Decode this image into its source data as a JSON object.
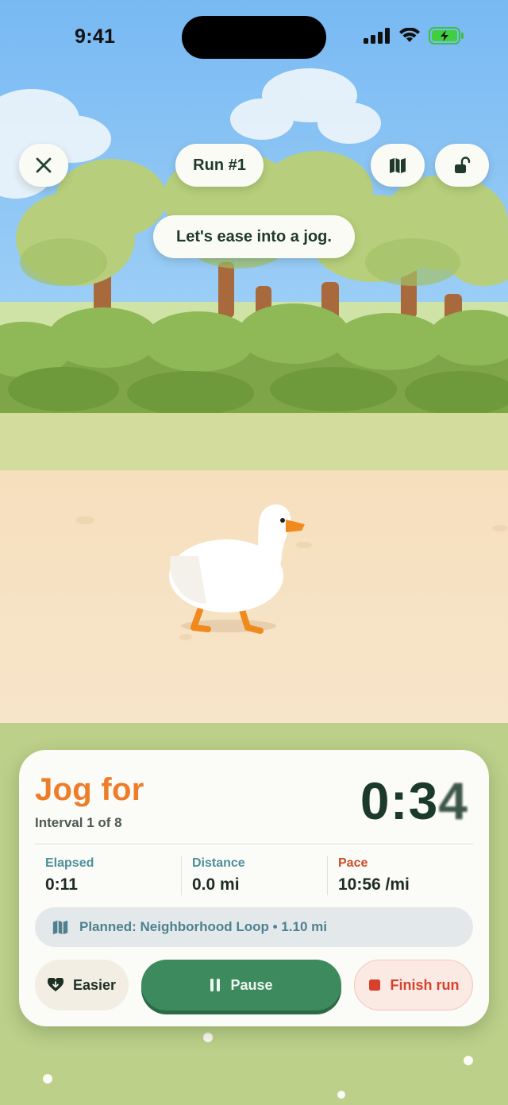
{
  "status_bar": {
    "time": "9:41",
    "icons": [
      "cellular-signal-icon",
      "wifi-icon",
      "battery-charging-icon"
    ]
  },
  "header": {
    "close_icon": "close-icon",
    "run_title": "Run #1",
    "map_icon": "map-icon",
    "lock_icon": "unlock-icon"
  },
  "coach_message": "Let's ease into a jog.",
  "workout": {
    "phase": "Jog for",
    "interval": "Interval 1 of 8",
    "countdown_main": "0:3",
    "countdown_blur": "4"
  },
  "stats": [
    {
      "label": "Elapsed",
      "value": "0:11"
    },
    {
      "label": "Distance",
      "value": "0.0 mi"
    },
    {
      "label": "Pace",
      "value": "10:56 /mi"
    }
  ],
  "route": {
    "icon": "map-icon",
    "text": "Planned: Neighborhood Loop • 1.10 mi"
  },
  "actions": {
    "easier": "Easier",
    "pause": "Pause",
    "finish": "Finish run"
  },
  "colors": {
    "accent_orange": "#ee7d2a",
    "primary_green": "#3e8a5f",
    "danger_red": "#d7412c",
    "teal_label": "#4e8f9b"
  }
}
